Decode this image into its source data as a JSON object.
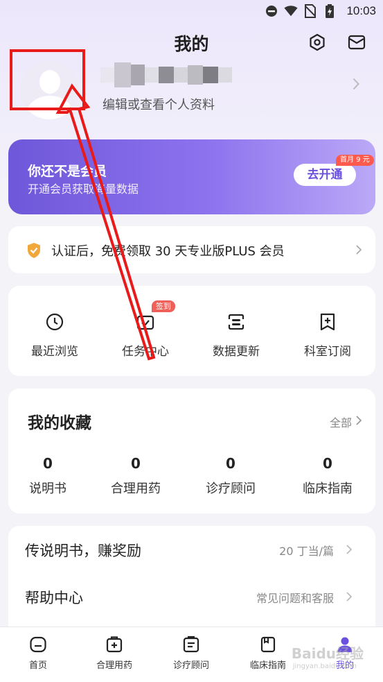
{
  "status_bar": {
    "time": "10:03",
    "icons": [
      "minus-circle-icon",
      "wifi-icon",
      "no-sim-icon",
      "battery-charging-icon"
    ]
  },
  "header": {
    "title": "我的",
    "settings_icon": "hexagon-settings-icon",
    "message_icon": "mail-icon"
  },
  "profile": {
    "hint": "编辑或查看个人资料"
  },
  "membership": {
    "title": "你还不是会员",
    "subtitle": "开通会员获取海量数据",
    "button": "去开通",
    "badge": "首月 9 元",
    "colors": {
      "start": "#6e57d9",
      "end": "#bba9f7"
    }
  },
  "certification": {
    "text": "认证后，免费领取 30 天专业版PLUS 会员"
  },
  "quick_actions": [
    {
      "label": "最近浏览",
      "icon": "clock-icon"
    },
    {
      "label": "任务中心",
      "icon": "task-check-icon",
      "badge": "签到"
    },
    {
      "label": "数据更新",
      "icon": "data-update-icon"
    },
    {
      "label": "科室订阅",
      "icon": "bookmark-plus-icon"
    }
  ],
  "favorites": {
    "title": "我的收藏",
    "all_label": "全部",
    "items": [
      {
        "count": "0",
        "label": "说明书"
      },
      {
        "count": "0",
        "label": "合理用药"
      },
      {
        "count": "0",
        "label": "诊疗顾问"
      },
      {
        "count": "0",
        "label": "临床指南"
      }
    ]
  },
  "menu": [
    {
      "label": "传说明书，赚奖励",
      "value": "20 丁当/篇"
    },
    {
      "label": "帮助中心",
      "value": "常见问题和客服"
    }
  ],
  "bottom_nav": [
    {
      "label": "首页",
      "icon": "home-icon"
    },
    {
      "label": "合理用药",
      "icon": "medicine-box-icon"
    },
    {
      "label": "诊疗顾问",
      "icon": "consult-icon"
    },
    {
      "label": "临床指南",
      "icon": "guide-book-icon"
    },
    {
      "label": "我的",
      "icon": "user-icon",
      "active": true
    }
  ],
  "watermark": "Baidu经验",
  "watermark_sub": "jingyan.baidu.com",
  "accent_color": "#6a4fe0"
}
